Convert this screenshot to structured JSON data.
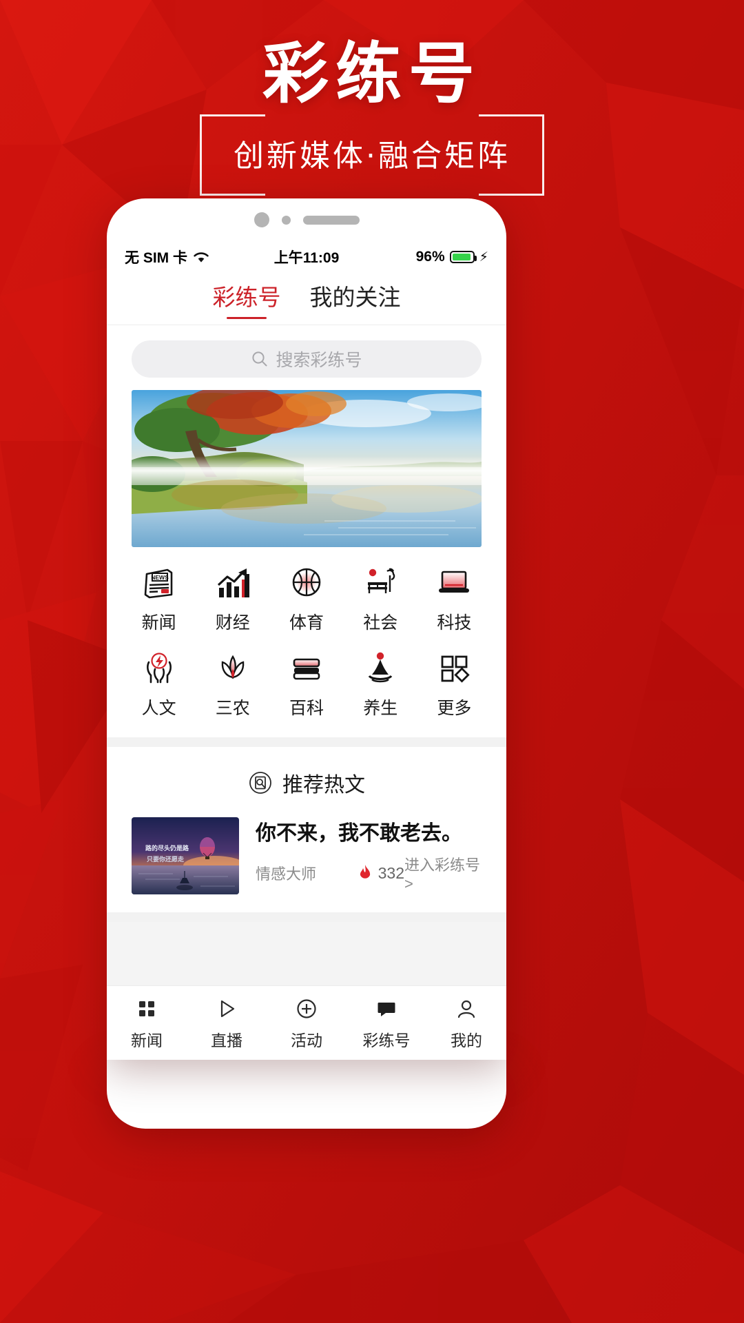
{
  "poster": {
    "title": "彩练号",
    "subtitle": "创新媒体·融合矩阵",
    "bg_color": "#c9100d"
  },
  "phone": {
    "statusbar": {
      "carrier": "无 SIM 卡",
      "wifi_icon": "wifi-icon",
      "time": "上午11:09",
      "battery_percent": "96%",
      "battery_icon": "battery-icon",
      "charging_icon": "charging-bolt-icon",
      "battery_color": "#35d24a"
    },
    "tabs": [
      {
        "label": "彩练号",
        "active": true
      },
      {
        "label": "我的关注",
        "active": false
      }
    ],
    "accent_color": "#cc2229",
    "search": {
      "placeholder": "搜索彩练号",
      "icon": "search-icon"
    },
    "banner": {
      "alt": "秋季湖畔晨雾风景图"
    },
    "categories": [
      {
        "label": "新闻",
        "icon": "newspaper-icon"
      },
      {
        "label": "财经",
        "icon": "bar-chart-arrow-icon"
      },
      {
        "label": "体育",
        "icon": "basketball-icon"
      },
      {
        "label": "社会",
        "icon": "bench-tree-icon"
      },
      {
        "label": "科技",
        "icon": "laptop-icon"
      },
      {
        "label": "人文",
        "icon": "hands-holding-icon"
      },
      {
        "label": "三农",
        "icon": "lotus-icon"
      },
      {
        "label": "百科",
        "icon": "books-icon"
      },
      {
        "label": "养生",
        "icon": "water-drop-icon"
      },
      {
        "label": "更多",
        "icon": "more-squares-icon"
      }
    ],
    "recommend": {
      "section_icon": "document-search-icon",
      "section_title": "推荐热文",
      "article": {
        "title": "你不来，我不敢老去。",
        "author": "情感大师",
        "hot_icon": "flame-icon",
        "hot_count": "332",
        "more_label": "进入彩练号 >",
        "thumb_text_line1": "路的尽头仍是路",
        "thumb_text_line2": "只要你还愿走"
      }
    },
    "tabbar": [
      {
        "label": "新闻",
        "icon": "grid-icon",
        "active": false
      },
      {
        "label": "直播",
        "icon": "play-icon",
        "active": false
      },
      {
        "label": "活动",
        "icon": "plus-circle-icon",
        "active": false
      },
      {
        "label": "彩练号",
        "icon": "chat-bubble-icon",
        "active": true
      },
      {
        "label": "我的",
        "icon": "person-icon",
        "active": false
      }
    ]
  }
}
